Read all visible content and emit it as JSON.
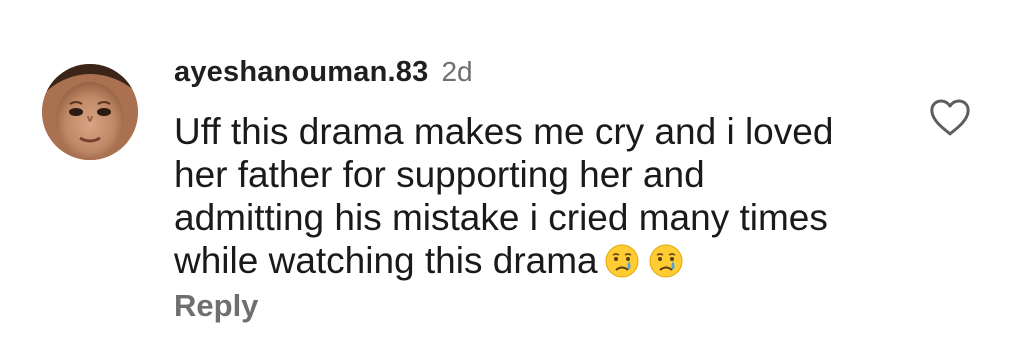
{
  "comment": {
    "username": "ayeshanouman.83",
    "timestamp": "2d",
    "text_lines": [
      "Uff this drama makes me cry and i loved",
      "her father for supporting her and",
      "admitting his mistake i cried many times",
      "while watching this drama"
    ],
    "emojis": [
      "crying-face-emoji",
      "crying-face-emoji"
    ],
    "reply_label": "Reply",
    "like_icon": "heart-outline-icon",
    "colors": {
      "username": "#1f1f1f",
      "secondary_text": "#6f6f6f",
      "body_text": "#1a1a1a",
      "background": "#ffffff"
    }
  }
}
